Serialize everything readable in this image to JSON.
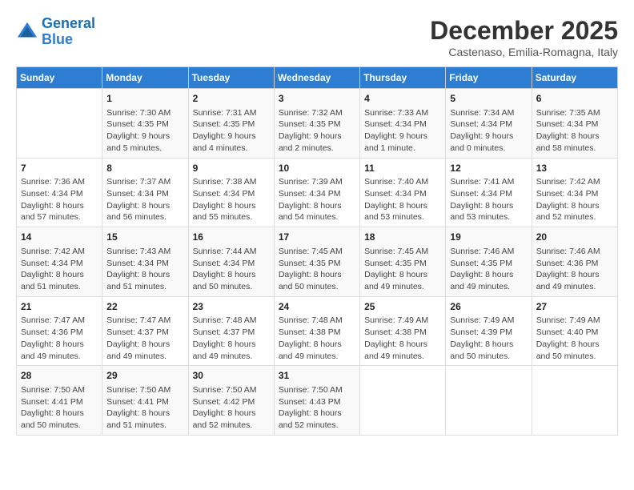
{
  "logo": {
    "line1": "General",
    "line2": "Blue"
  },
  "title": "December 2025",
  "subtitle": "Castenaso, Emilia-Romagna, Italy",
  "weekdays": [
    "Sunday",
    "Monday",
    "Tuesday",
    "Wednesday",
    "Thursday",
    "Friday",
    "Saturday"
  ],
  "weeks": [
    [
      {
        "day": "",
        "sunrise": "",
        "sunset": "",
        "daylight": ""
      },
      {
        "day": "1",
        "sunrise": "Sunrise: 7:30 AM",
        "sunset": "Sunset: 4:35 PM",
        "daylight": "Daylight: 9 hours and 5 minutes."
      },
      {
        "day": "2",
        "sunrise": "Sunrise: 7:31 AM",
        "sunset": "Sunset: 4:35 PM",
        "daylight": "Daylight: 9 hours and 4 minutes."
      },
      {
        "day": "3",
        "sunrise": "Sunrise: 7:32 AM",
        "sunset": "Sunset: 4:35 PM",
        "daylight": "Daylight: 9 hours and 2 minutes."
      },
      {
        "day": "4",
        "sunrise": "Sunrise: 7:33 AM",
        "sunset": "Sunset: 4:34 PM",
        "daylight": "Daylight: 9 hours and 1 minute."
      },
      {
        "day": "5",
        "sunrise": "Sunrise: 7:34 AM",
        "sunset": "Sunset: 4:34 PM",
        "daylight": "Daylight: 9 hours and 0 minutes."
      },
      {
        "day": "6",
        "sunrise": "Sunrise: 7:35 AM",
        "sunset": "Sunset: 4:34 PM",
        "daylight": "Daylight: 8 hours and 58 minutes."
      }
    ],
    [
      {
        "day": "7",
        "sunrise": "Sunrise: 7:36 AM",
        "sunset": "Sunset: 4:34 PM",
        "daylight": "Daylight: 8 hours and 57 minutes."
      },
      {
        "day": "8",
        "sunrise": "Sunrise: 7:37 AM",
        "sunset": "Sunset: 4:34 PM",
        "daylight": "Daylight: 8 hours and 56 minutes."
      },
      {
        "day": "9",
        "sunrise": "Sunrise: 7:38 AM",
        "sunset": "Sunset: 4:34 PM",
        "daylight": "Daylight: 8 hours and 55 minutes."
      },
      {
        "day": "10",
        "sunrise": "Sunrise: 7:39 AM",
        "sunset": "Sunset: 4:34 PM",
        "daylight": "Daylight: 8 hours and 54 minutes."
      },
      {
        "day": "11",
        "sunrise": "Sunrise: 7:40 AM",
        "sunset": "Sunset: 4:34 PM",
        "daylight": "Daylight: 8 hours and 53 minutes."
      },
      {
        "day": "12",
        "sunrise": "Sunrise: 7:41 AM",
        "sunset": "Sunset: 4:34 PM",
        "daylight": "Daylight: 8 hours and 53 minutes."
      },
      {
        "day": "13",
        "sunrise": "Sunrise: 7:42 AM",
        "sunset": "Sunset: 4:34 PM",
        "daylight": "Daylight: 8 hours and 52 minutes."
      }
    ],
    [
      {
        "day": "14",
        "sunrise": "Sunrise: 7:42 AM",
        "sunset": "Sunset: 4:34 PM",
        "daylight": "Daylight: 8 hours and 51 minutes."
      },
      {
        "day": "15",
        "sunrise": "Sunrise: 7:43 AM",
        "sunset": "Sunset: 4:34 PM",
        "daylight": "Daylight: 8 hours and 51 minutes."
      },
      {
        "day": "16",
        "sunrise": "Sunrise: 7:44 AM",
        "sunset": "Sunset: 4:34 PM",
        "daylight": "Daylight: 8 hours and 50 minutes."
      },
      {
        "day": "17",
        "sunrise": "Sunrise: 7:45 AM",
        "sunset": "Sunset: 4:35 PM",
        "daylight": "Daylight: 8 hours and 50 minutes."
      },
      {
        "day": "18",
        "sunrise": "Sunrise: 7:45 AM",
        "sunset": "Sunset: 4:35 PM",
        "daylight": "Daylight: 8 hours and 49 minutes."
      },
      {
        "day": "19",
        "sunrise": "Sunrise: 7:46 AM",
        "sunset": "Sunset: 4:35 PM",
        "daylight": "Daylight: 8 hours and 49 minutes."
      },
      {
        "day": "20",
        "sunrise": "Sunrise: 7:46 AM",
        "sunset": "Sunset: 4:36 PM",
        "daylight": "Daylight: 8 hours and 49 minutes."
      }
    ],
    [
      {
        "day": "21",
        "sunrise": "Sunrise: 7:47 AM",
        "sunset": "Sunset: 4:36 PM",
        "daylight": "Daylight: 8 hours and 49 minutes."
      },
      {
        "day": "22",
        "sunrise": "Sunrise: 7:47 AM",
        "sunset": "Sunset: 4:37 PM",
        "daylight": "Daylight: 8 hours and 49 minutes."
      },
      {
        "day": "23",
        "sunrise": "Sunrise: 7:48 AM",
        "sunset": "Sunset: 4:37 PM",
        "daylight": "Daylight: 8 hours and 49 minutes."
      },
      {
        "day": "24",
        "sunrise": "Sunrise: 7:48 AM",
        "sunset": "Sunset: 4:38 PM",
        "daylight": "Daylight: 8 hours and 49 minutes."
      },
      {
        "day": "25",
        "sunrise": "Sunrise: 7:49 AM",
        "sunset": "Sunset: 4:38 PM",
        "daylight": "Daylight: 8 hours and 49 minutes."
      },
      {
        "day": "26",
        "sunrise": "Sunrise: 7:49 AM",
        "sunset": "Sunset: 4:39 PM",
        "daylight": "Daylight: 8 hours and 50 minutes."
      },
      {
        "day": "27",
        "sunrise": "Sunrise: 7:49 AM",
        "sunset": "Sunset: 4:40 PM",
        "daylight": "Daylight: 8 hours and 50 minutes."
      }
    ],
    [
      {
        "day": "28",
        "sunrise": "Sunrise: 7:50 AM",
        "sunset": "Sunset: 4:41 PM",
        "daylight": "Daylight: 8 hours and 50 minutes."
      },
      {
        "day": "29",
        "sunrise": "Sunrise: 7:50 AM",
        "sunset": "Sunset: 4:41 PM",
        "daylight": "Daylight: 8 hours and 51 minutes."
      },
      {
        "day": "30",
        "sunrise": "Sunrise: 7:50 AM",
        "sunset": "Sunset: 4:42 PM",
        "daylight": "Daylight: 8 hours and 52 minutes."
      },
      {
        "day": "31",
        "sunrise": "Sunrise: 7:50 AM",
        "sunset": "Sunset: 4:43 PM",
        "daylight": "Daylight: 8 hours and 52 minutes."
      },
      {
        "day": "",
        "sunrise": "",
        "sunset": "",
        "daylight": ""
      },
      {
        "day": "",
        "sunrise": "",
        "sunset": "",
        "daylight": ""
      },
      {
        "day": "",
        "sunrise": "",
        "sunset": "",
        "daylight": ""
      }
    ]
  ]
}
